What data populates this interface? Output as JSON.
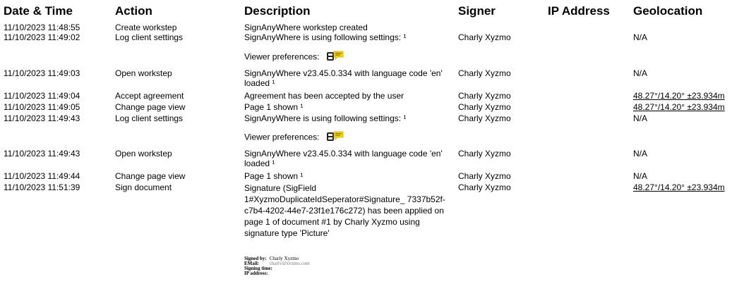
{
  "headers": [
    "Date & Time",
    "Action",
    "Description",
    "Signer",
    "IP Address",
    "Geolocation"
  ],
  "rows": [
    {
      "date": "11/10/2023 11:48:55",
      "action": "Create workstep",
      "desc": "SignAnyWhere workstep created",
      "signer": "",
      "geo": ""
    },
    {
      "date": "11/10/2023 11:49:02",
      "action": "Log client settings",
      "desc": "SignAnyWhere is using following settings: ¹",
      "signer": "Charly Xyzmo",
      "geo": "N/A"
    },
    {
      "date": "11/10/2023 11:49:03",
      "action": "Open workstep",
      "desc": "SignAnyWhere v23.45.0.334 with language code 'en' loaded ¹",
      "signer": "Charly Xyzmo",
      "geo": "N/A"
    },
    {
      "date": "11/10/2023 11:49:04",
      "action": "Accept agreement",
      "desc": "Agreement has been accepted by the user",
      "signer": "Charly Xyzmo",
      "geo": "48.27°/14.20° ±23.934m"
    },
    {
      "date": "11/10/2023 11:49:05",
      "action": "Change page view",
      "desc": "Page 1 shown ¹",
      "signer": "Charly Xyzmo",
      "geo": "48.27°/14.20° ±23.934m"
    },
    {
      "date": "11/10/2023 11:49:43",
      "action": "Log client settings",
      "desc": "SignAnyWhere is using following settings: ¹",
      "signer": "Charly Xyzmo",
      "geo": "N/A"
    },
    {
      "date": "11/10/2023 11:49:43",
      "action": "Open workstep",
      "desc": "SignAnyWhere v23.45.0.334 with language code 'en' loaded ¹",
      "signer": "Charly Xyzmo",
      "geo": "N/A"
    },
    {
      "date": "11/10/2023 11:49:44",
      "action": "Change page view",
      "desc": "Page 1 shown ¹",
      "signer": "Charly Xyzmo",
      "geo": "N/A"
    },
    {
      "date": "11/10/2023 11:51:39",
      "action": "Sign document",
      "desc": "Signature (SigField 1#XyzmoDuplicateIdSeperator#Signature_ 7337b52f-c7b4-4202-44e7-23f1e176c272) has been applied on page 1 of document #1 by Charly Xyzmo using signature type 'Picture'",
      "signer": "Charly Xyzmo",
      "geo": "48.27°/14.20° ±23.934m"
    }
  ],
  "viewer_preferences_label": "Viewer preferences:",
  "signature_block": {
    "signed_by_label": "Signed by:",
    "signed_by_value": "Charly Xyzmo",
    "email_label": "EMail:",
    "email_value": "charly@xyzmo.com",
    "signing_time_label": "Signing time:",
    "ip_address_label": "IP address:"
  },
  "colors": {
    "text": "#000000",
    "icon_yellow": "#f5d600",
    "icon_dark": "#222222"
  }
}
